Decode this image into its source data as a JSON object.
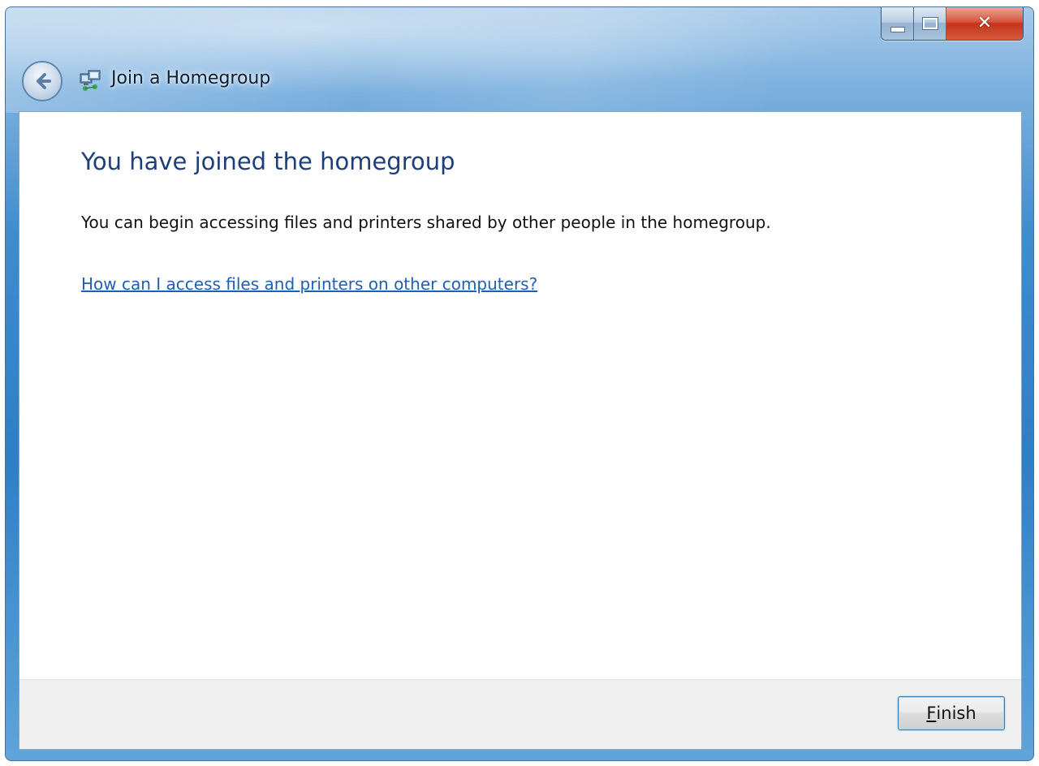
{
  "window": {
    "title": "Join a Homegroup",
    "close_glyph": "✕"
  },
  "content": {
    "heading": "You have joined the homegroup",
    "description": "You can begin accessing files and printers shared by other people in the homegroup.",
    "help_link": "How can I access files and printers on other computers?"
  },
  "footer": {
    "finish_accel": "F",
    "finish_rest": "inish"
  },
  "icons": {
    "back": "back-arrow-icon",
    "title": "homegroup-icon",
    "minimize": "minimize-icon",
    "maximize": "maximize-icon",
    "close": "close-icon"
  },
  "colors": {
    "heading": "#1e3e7a",
    "link": "#1f5fb2",
    "titlebar": "#2f7fc6",
    "close_button": "#c4331a",
    "footer": "#f0f0f0"
  }
}
